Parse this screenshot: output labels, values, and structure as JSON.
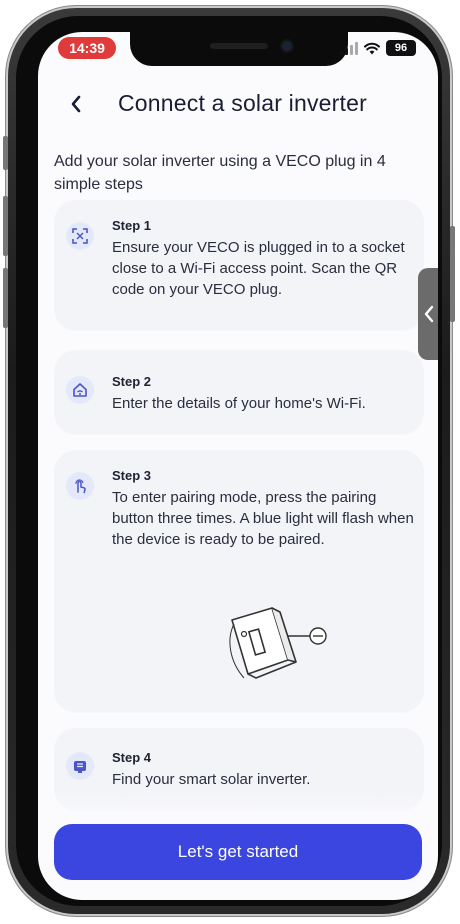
{
  "status_bar": {
    "time": "14:39",
    "battery": "96"
  },
  "header": {
    "title": "Connect a solar inverter"
  },
  "intro": "Add your solar inverter using a VECO plug in 4 simple steps",
  "steps": [
    {
      "title": "Step 1",
      "text": "Ensure your VECO is plugged in to a socket close to a Wi-Fi access point. Scan the QR code on your VECO plug.",
      "icon": "qr-scan-icon"
    },
    {
      "title": "Step 2",
      "text": "Enter the details of your home's Wi-Fi.",
      "icon": "home-wifi-icon"
    },
    {
      "title": "Step 3",
      "text": "To enter pairing mode, press the pairing button three times. A blue light will flash when the device is ready to be paired.",
      "icon": "press-finger-icon"
    },
    {
      "title": "Step 4",
      "text": "Find your smart solar inverter.",
      "icon": "inverter-icon"
    }
  ],
  "cta": {
    "label": "Let's get started"
  },
  "colors": {
    "accent": "#3b45e0",
    "time_pill": "#e03a3a",
    "icon_bg": "#e4e8fb"
  }
}
